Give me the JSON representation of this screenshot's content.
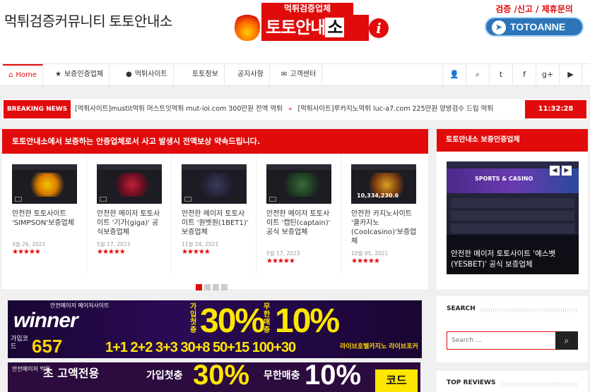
{
  "header": {
    "site_title": "먹튀검증커뮤니티 토토안내소",
    "banner1_top": "먹튀검증업체",
    "banner1_main_a": "토토안내",
    "banner1_main_b": "소",
    "banner1_info": "i",
    "banner2_top": "검증 /신고 / 제휴문의",
    "banner2_handle": "TOTOANNE"
  },
  "nav": {
    "items": [
      {
        "label": "Home",
        "icon": "home-icon"
      },
      {
        "label": "보증인증업체",
        "icon": "star-icon"
      },
      {
        "label": "먹튀사이트",
        "icon": "bomb-icon"
      },
      {
        "label": "토토정보"
      },
      {
        "label": "공지사항"
      },
      {
        "label": "고객센터",
        "icon": "envelope-icon"
      }
    ],
    "social": [
      "user-icon",
      "search-icon",
      "twitter-icon",
      "facebook-icon",
      "google-plus-icon",
      "youtube-icon"
    ],
    "social_glyphs": [
      "👤",
      "⌕",
      "t",
      "f",
      "g+",
      "▶"
    ]
  },
  "breaking": {
    "label": "BREAKING NEWS",
    "item1": "[먹튀사이트]mustit먹튀 머스트잇먹튀 mut-ioi.com 300만원 전액 먹튀",
    "item2": "[먹튀사이트]루카지노먹튀 luc-a7.com 225만원 양방검수 드립 먹튀",
    "time": "11:32:28"
  },
  "featured": {
    "heading": "토토안내소에서 보증하는 안증업체로서 사고 발생시 전액보상 약속드립니다.",
    "cards": [
      {
        "title": "안전한 토토사이트 'SIMPSON'보증업체",
        "date": "4월 26, 2021",
        "rating": 5
      },
      {
        "title": "안전한 메이저 토토사이트 '기가(giga)' 공식보증업체",
        "date": "5월 17, 2023",
        "rating": 5
      },
      {
        "title": "안전한 메이저 토토사이트 '원벳원(1BET1)' 보증업체",
        "date": "11월 24, 2021",
        "rating": 5
      },
      {
        "title": "안전한 메이저 토토사이트 '캡틴(captain)' 공식 보증업체",
        "date": "5월 17, 2023",
        "rating": 5
      },
      {
        "title": "안전한 카지노사이트 '쿨카지노(Coolcasino)'보증업체",
        "date": "10월 05, 2021",
        "rating": 5
      }
    ],
    "thumb_banner": "10,334,230.6",
    "stars": "★★★★★"
  },
  "sidebar": {
    "box1_heading": "토토안내소 보증인증업체",
    "box1_caption": "안전한 메이저 토토사이트 '예스벳(YESBET)' 공식 보증업체",
    "box1_img_text": "SPORTS & CASINO",
    "prev": "◀",
    "next": "▶",
    "search_heading": "SEARCH",
    "search_placeholder": "Search ...",
    "search_icon": "⌕",
    "reviews_heading": "TOP REVIEWS"
  },
  "ads": {
    "ad1": {
      "top": "안전메이저 메이저사이트",
      "brand": "winner",
      "code_label": "가입코드",
      "code": "657",
      "pct1": "30%",
      "pct2": "10%",
      "pct1_label": "가입첫충",
      "pct2_label": "무한매충",
      "bonus": "1+1 2+2 3+3 30+8 50+15 100+30",
      "side_text": "라이브호텔카지노 라이브포커"
    },
    "ad2": {
      "label": "안전메이저 먹튀",
      "line": "초 고액전용",
      "pct1": "30%",
      "pct2": "10%",
      "pct1_label": "가입첫충",
      "pct2_label": "무한매충",
      "code": "코드"
    }
  },
  "colors": {
    "accent": "#e10b0b",
    "dark": "#222222"
  }
}
